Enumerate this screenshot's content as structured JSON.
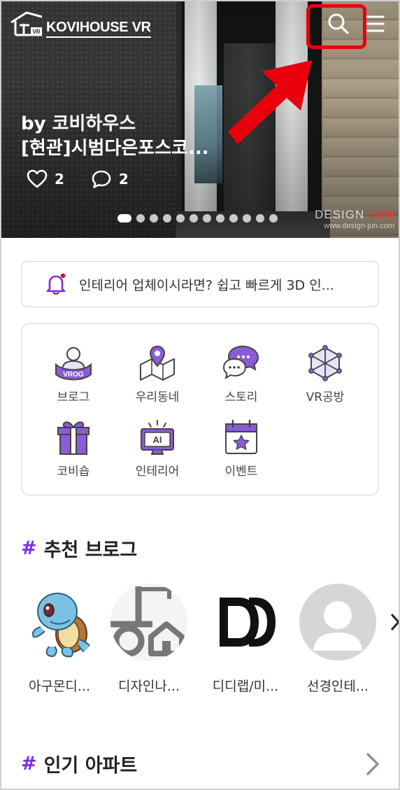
{
  "app": {
    "logo_text": "KOVIHOUSE VR",
    "logo_badge": "VR"
  },
  "hero": {
    "author": "by 코비하우스",
    "title": "[현관]시범다은포스코...",
    "likes": "2",
    "comments": "2",
    "slide_count": 12,
    "active_slide": 1,
    "watermark_brand_a": "DESIGN",
    "watermark_brand_b": "JUN",
    "watermark_url": "www.design-jun.com"
  },
  "header": {
    "search_icon": "search-icon",
    "menu_icon": "hamburger-menu-icon"
  },
  "notice": {
    "icon": "bell-icon",
    "text": "인테리어 업체이시라면? 쉽고 빠르게 3D 인..."
  },
  "menu": {
    "items": [
      {
        "label": "브로그",
        "icon": "vrog-icon"
      },
      {
        "label": "우리동네",
        "icon": "map-pin-icon"
      },
      {
        "label": "스토리",
        "icon": "chat-bubbles-icon"
      },
      {
        "label": "VR공방",
        "icon": "cube-network-icon"
      },
      {
        "label": "코비숍",
        "icon": "gift-box-icon"
      },
      {
        "label": "인테리어",
        "icon": "ai-monitor-icon"
      },
      {
        "label": "이벤트",
        "icon": "calendar-star-icon"
      }
    ],
    "vrog_icon_text": "VROG",
    "ai_icon_text": "AI"
  },
  "sections": {
    "recommended_title": "추천 브로그",
    "popular_title": "인기 아파트",
    "hash": "#"
  },
  "blogs": [
    {
      "name": "아구몬디...",
      "avatar": "turtle-character-avatar"
    },
    {
      "name": "디자인나...",
      "avatar": "house-logo-avatar"
    },
    {
      "name": "디디랩/미...",
      "avatar": "dd-logo-avatar"
    },
    {
      "name": "선경인테...",
      "avatar": "default-user-avatar"
    }
  ],
  "colors": {
    "accent": "#7d2ae8",
    "highlight": "#e8000c",
    "border": "#d4d4d4"
  }
}
